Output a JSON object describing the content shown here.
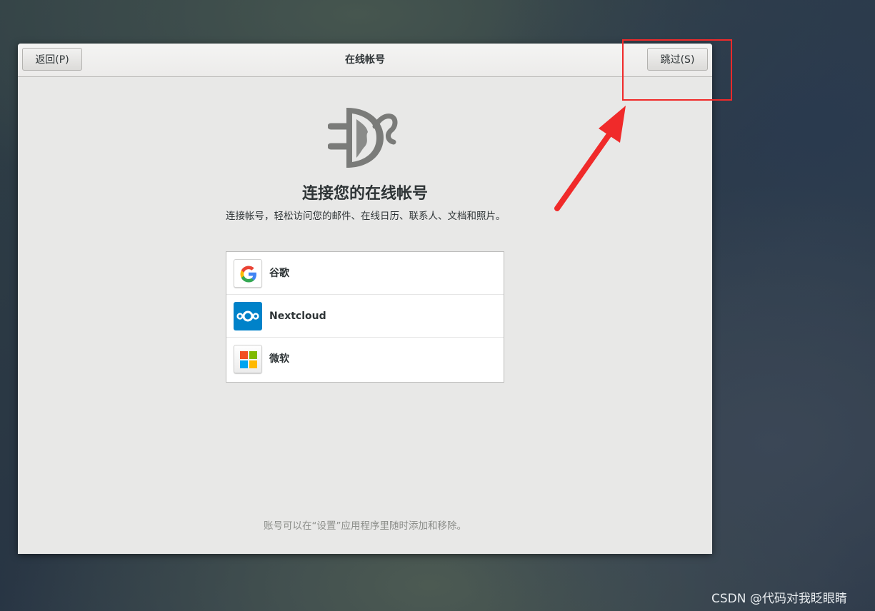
{
  "header": {
    "title": "在线帐号",
    "back_label": "返回(P)",
    "skip_label": "跳过(S)"
  },
  "main": {
    "icon": "online-accounts-icon",
    "heading": "连接您的在线帐号",
    "description": "连接帐号，轻松访问您的邮件、在线日历、联系人、文档和照片。",
    "providers": [
      {
        "label": "谷歌",
        "icon": "google-icon"
      },
      {
        "label": "Nextcloud",
        "icon": "nextcloud-icon"
      },
      {
        "label": "微软",
        "icon": "microsoft-icon"
      }
    ],
    "footer_note": "账号可以在“设置”应用程序里随时添加和移除。"
  },
  "watermark": "CSDN @代码对我眨眼睛",
  "colors": {
    "annotation": "#f02a2a",
    "nextcloud_blue": "#0082c9"
  }
}
